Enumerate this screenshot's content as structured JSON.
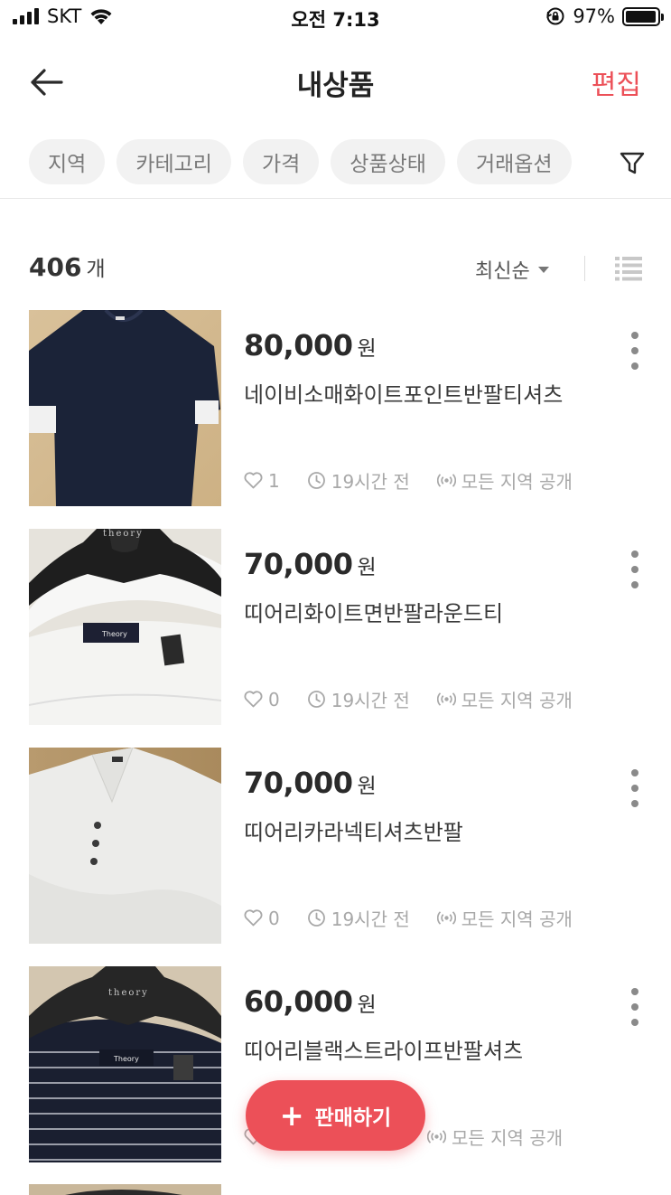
{
  "status_bar": {
    "carrier": "SKT",
    "time": "오전 7:13",
    "battery": "97%",
    "battery_level": 0.97
  },
  "nav": {
    "title": "내상품",
    "edit_label": "편집",
    "back_icon": "arrow-left-icon"
  },
  "filters": [
    "지역",
    "카테고리",
    "가격",
    "상품상태",
    "거래옵션"
  ],
  "list_header": {
    "count": "406",
    "count_unit": "개",
    "sort_label": "최신순"
  },
  "items": [
    {
      "price": "80,000",
      "currency": "원",
      "title": "네이비소매화이트포인트반팔티셔츠",
      "likes": "1",
      "time": "19시간 전",
      "visibility": "모든 지역 공개"
    },
    {
      "price": "70,000",
      "currency": "원",
      "title": "띠어리화이트면반팔라운드티",
      "likes": "0",
      "time": "19시간 전",
      "visibility": "모든 지역 공개"
    },
    {
      "price": "70,000",
      "currency": "원",
      "title": "띠어리카라넥티셔츠반팔",
      "likes": "0",
      "time": "19시간 전",
      "visibility": "모든 지역 공개"
    },
    {
      "price": "60,000",
      "currency": "원",
      "title": "띠어리블랙스트라이프반팔셔츠",
      "likes": "",
      "time": "",
      "visibility": "모든 지역 공개"
    }
  ],
  "fab": {
    "label": "판매하기"
  },
  "colors": {
    "accent": "#ec5058",
    "chip_bg": "#f2f2f2",
    "meta_text": "#a8a8a8"
  },
  "image_labels": {
    "hanger_brand": "theory",
    "garment_tag": "Theory"
  }
}
